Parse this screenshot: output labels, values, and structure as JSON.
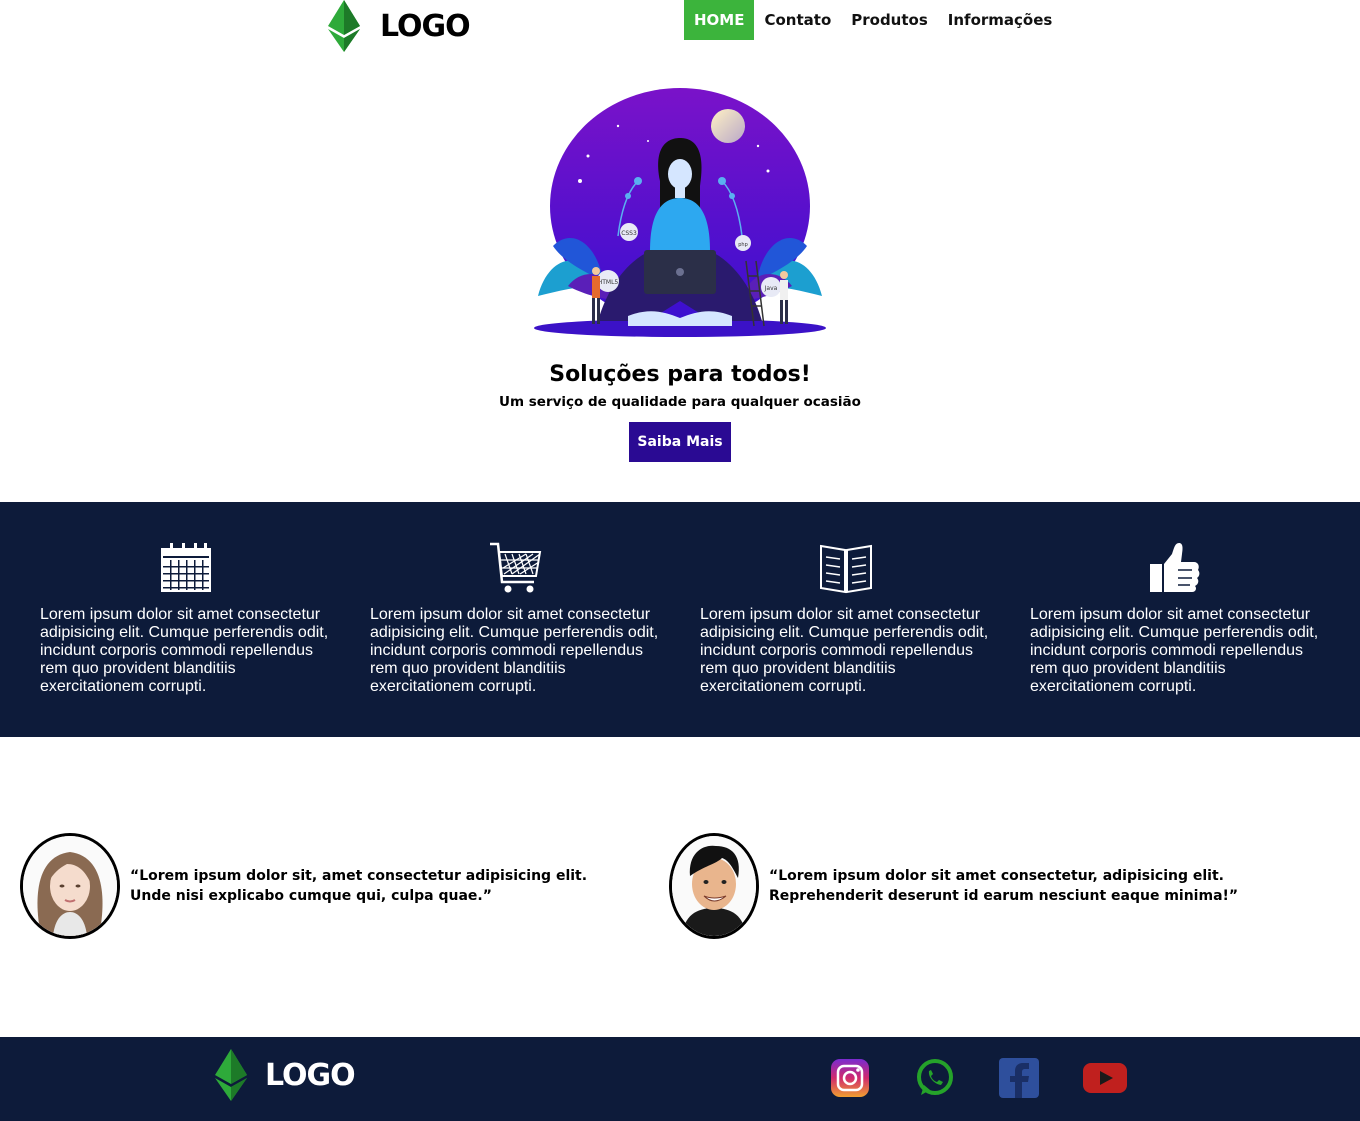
{
  "header": {
    "logo_text": "LOGO",
    "nav": [
      "HOME",
      "Contato",
      "Produtos",
      "Informações"
    ]
  },
  "hero": {
    "title": "Soluções para todos!",
    "subtitle": "Um serviço de qualidade para qualquer ocasião",
    "button": "Saiba Mais",
    "illustration_labels": [
      "CSS3",
      "HTML5",
      "php",
      "Java"
    ]
  },
  "features": [
    {
      "icon": "calendar-icon",
      "text": "Lorem ipsum dolor sit amet consectetur adipisicing elit. Cumque perferendis odit, incidunt corporis commodi repellendus rem quo provident blanditiis exercitationem corrupti."
    },
    {
      "icon": "cart-icon",
      "text": "Lorem ipsum dolor sit amet consectetur adipisicing elit. Cumque perferendis odit, incidunt corporis commodi repellendus rem quo provident blanditiis exercitationem corrupti."
    },
    {
      "icon": "book-icon",
      "text": "Lorem ipsum dolor sit amet consectetur adipisicing elit. Cumque perferendis odit, incidunt corporis commodi repellendus rem quo provident blanditiis exercitationem corrupti."
    },
    {
      "icon": "thumbs-up-icon",
      "text": "Lorem ipsum dolor sit amet consectetur adipisicing elit. Cumque perferendis odit, incidunt corporis commodi repellendus rem quo provident blanditiis exercitationem corrupti."
    }
  ],
  "testimonials": [
    {
      "avatar": "woman-avatar",
      "quote": "“Lorem ipsum dolor sit, amet consectetur adipisicing elit. Unde nisi explicabo cumque qui, culpa quae.”"
    },
    {
      "avatar": "man-avatar",
      "quote": "“Lorem ipsum dolor sit amet consectetur, adipisicing elit. Reprehenderit deserunt id earum nesciunt eaque minima!”"
    }
  ],
  "footer": {
    "logo_text": "LOGO",
    "social": [
      "instagram-icon",
      "whatsapp-icon",
      "facebook-icon",
      "youtube-icon"
    ]
  },
  "colors": {
    "nav_active": "#3cb43c",
    "cta": "#2a0a93",
    "dark_band": "#0d1b3a"
  }
}
